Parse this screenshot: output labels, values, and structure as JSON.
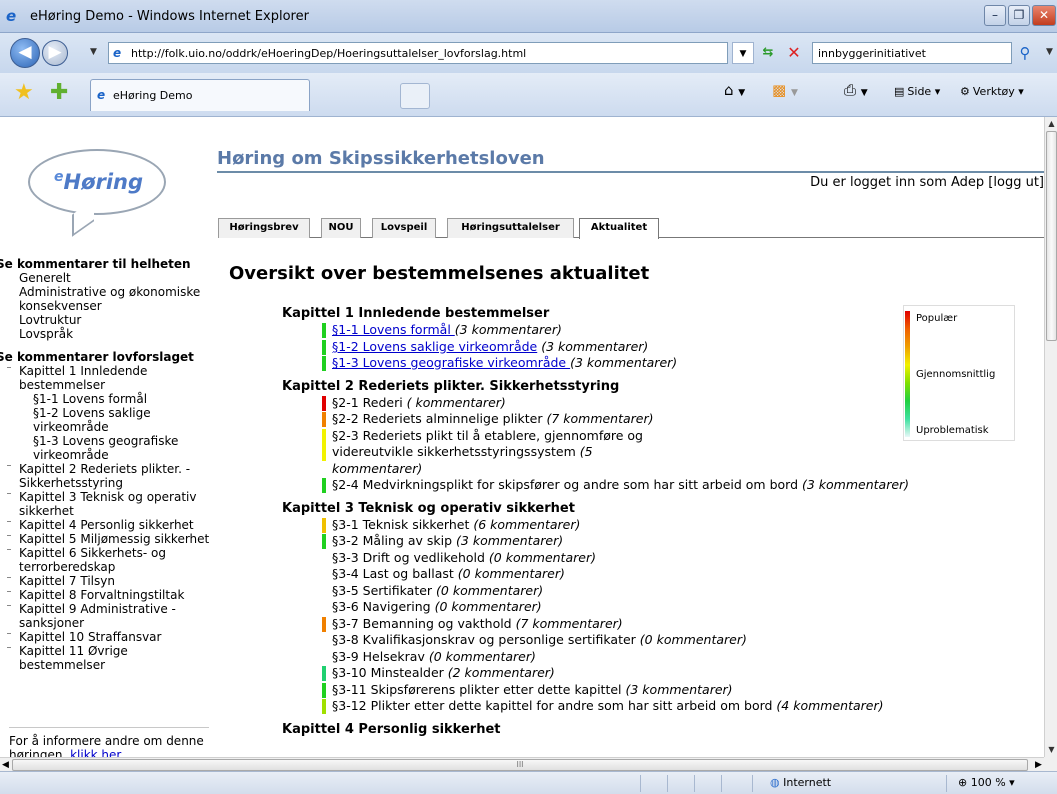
{
  "browser": {
    "window_title": "eHøring Demo - Windows Internet Explorer",
    "address_url": "http://folk.uio.no/oddrk/eHoeringDep/Hoeringsuttalelser_lovforslag.html",
    "search_text": "innbyggerinitiativet",
    "tab_title": "eHøring Demo",
    "tools": {
      "page": "Side",
      "tools": "Verktøy"
    },
    "status": {
      "zone": "Internett",
      "zoom": "100 %"
    },
    "hscroll_label": "III"
  },
  "colors": {
    "popular": "#e00000",
    "average": "#f2f200",
    "unproblematic": "#e8f8f8",
    "link": "#0000cc",
    "heading": "#5b7aa8"
  },
  "page": {
    "logo_text": "Høring",
    "logo_prefix": "e",
    "title": "Høring om Skipssikkerhetsloven",
    "login_text": "Du er logget inn som Adep [logg ut]",
    "tabs": [
      "Høringsbrev",
      "NOU",
      "Lovspeil",
      "Høringsuttalelser",
      "Aktualitet"
    ],
    "active_tab": "Aktualitet",
    "main_title": "Oversikt over bestemmelsenes aktualitet"
  },
  "sidebar": {
    "section1_title": "Se kommentarer til helheten",
    "section1_items": [
      "Generelt",
      "Administrative og økonomiske konsekvenser",
      "Lovtruktur",
      "Lovspråk"
    ],
    "section2_title": "Se kommentarer lovforslaget",
    "chapter1": "Kapittel 1 Innledende bestemmelser",
    "chapter1_items": [
      "§1-1 Lovens formål",
      "§1-2 Lovens saklige virkeområde",
      "§1-3 Lovens geografiske virkeområde"
    ],
    "chapters": [
      "Kapittel 2 Rederiets plikter. - Sikkerhetsstyring",
      "Kapittel 3 Teknisk og operativ sikkerhet",
      "Kapittel 4 Personlig sikkerhet",
      "Kapittel 5 Miljømessig sikkerhet",
      "Kapittel 6 Sikkerhets- og terrorberedskap",
      "Kapittel 7 Tilsyn",
      "Kapittel 8 Forvaltningstiltak",
      "Kapittel 9 Administrative - sanksjoner",
      "Kapittel 10 Straffansvar",
      "Kapittel 11 Øvrige bestemmelser"
    ],
    "inform_text": "For å informere andre om denne høringen,",
    "inform_link": "klikk her"
  },
  "legend": {
    "top": "Populær",
    "middle": "Gjennomsnittlig",
    "bottom": "Uproblematisk"
  },
  "overview": {
    "chapter1": {
      "title": "Kapittel 1 Innledende bestemmelser",
      "items": [
        {
          "text": "§1-1 Lovens formål ",
          "comments": "(3 kommentarer)",
          "color": "#20d020"
        },
        {
          "text": "§1-2 Lovens saklige virkeområde",
          "comments": " (3 kommentarer)",
          "color": "#20d020"
        },
        {
          "text": "§1-3 Lovens geografiske virkeområde ",
          "comments": "(3 kommentarer)",
          "color": "#20d020"
        }
      ]
    },
    "chapter2": {
      "title": "Kapittel 2 Rederiets plikter. Sikkerhetsstyring",
      "items": [
        {
          "text": "§2-1 Rederi ",
          "comments": "( kommentarer)",
          "color": "#e00000"
        },
        {
          "text": "§2-2 Rederiets alminnelige plikter ",
          "comments": "(7 kommentarer)",
          "color": "#f08000"
        },
        {
          "text": "§2-3 Rederiets plikt til å etablere, gjennomføre og videreutvikle sikkerhetsstyringssystem ",
          "comments": "(5 kommentarer)",
          "color": "#f2f200"
        },
        {
          "text": "§2-4 Medvirkningsplikt for skipsfører og andre som har sitt arbeid om bord ",
          "comments": "(3 kommentarer)",
          "color": "#20d020"
        }
      ]
    },
    "chapter3": {
      "title": "Kapittel 3 Teknisk og operativ sikkerhet",
      "items": [
        {
          "text": "§3-1 Teknisk sikkerhet ",
          "comments": "(6 kommentarer)",
          "color": "#f0c000"
        },
        {
          "text": "§3-2 Måling av skip ",
          "comments": "(3 kommentarer)",
          "color": "#20d020"
        },
        {
          "text": "§3-3 Drift og vedlikehold ",
          "comments": "(0 kommentarer)",
          "color": ""
        },
        {
          "text": "§3-4 Last og ballast ",
          "comments": "(0 kommentarer)",
          "color": ""
        },
        {
          "text": "§3-5 Sertifikater ",
          "comments": "(0 kommentarer)",
          "color": ""
        },
        {
          "text": "§3-6 Navigering ",
          "comments": "(0 kommentarer)",
          "color": ""
        },
        {
          "text": "§3-7 Bemanning og vakthold ",
          "comments": "(7 kommentarer)",
          "color": "#f08000"
        },
        {
          "text": "§3-8 Kvalifikasjonskrav og personlige sertifikater ",
          "comments": "(0 kommentarer)",
          "color": ""
        },
        {
          "text": "§3-9 Helsekrav ",
          "comments": "(0 kommentarer)",
          "color": ""
        },
        {
          "text": "§3-10 Minstealder ",
          "comments": "(2 kommentarer)",
          "color": "#20d070"
        },
        {
          "text": "§3-11 Skipsførerens plikter etter dette kapittel ",
          "comments": "(3 kommentarer)",
          "color": "#20d020"
        },
        {
          "text": "§3-12 Plikter etter dette kapittel for andre som har sitt arbeid om bord ",
          "comments": "(4 kommentarer)",
          "color": "#a0e000"
        }
      ]
    },
    "chapter4": {
      "title": "Kapittel 4 Personlig sikkerhet"
    }
  }
}
